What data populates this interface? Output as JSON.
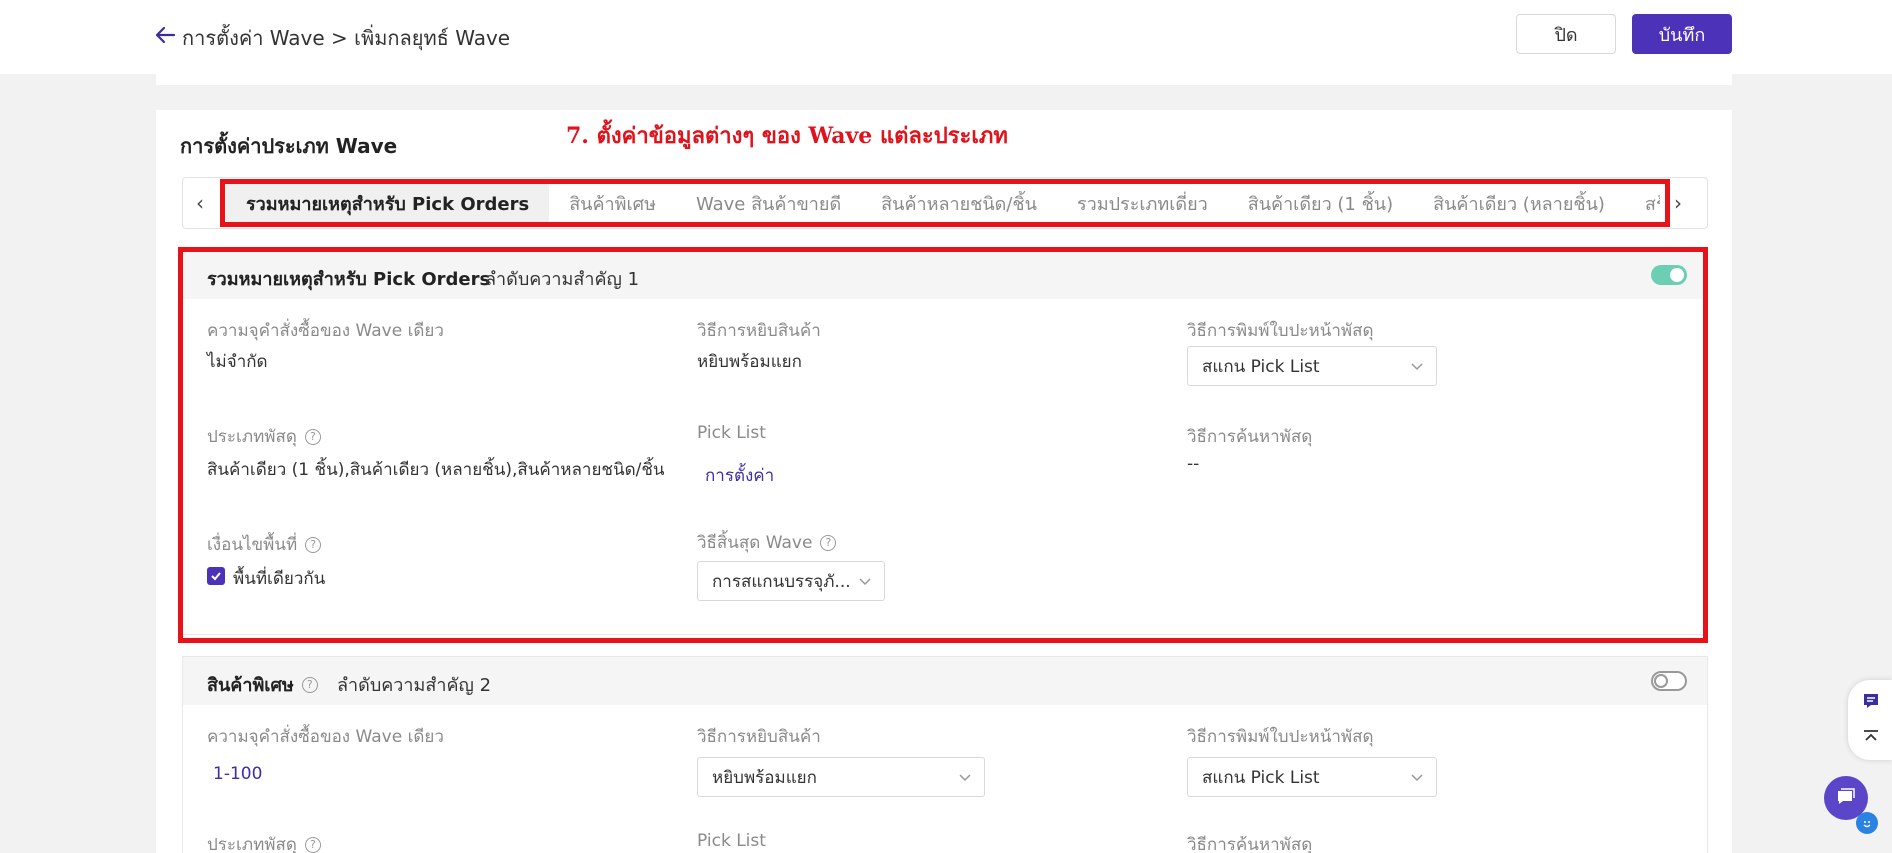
{
  "header": {
    "breadcrumb": "การตั้งค่า Wave > เพิ่มกลยุทธ์ Wave",
    "close_label": "ปิด",
    "save_label": "บันทึก"
  },
  "section": {
    "title": "การตั้งค่าประเภท Wave",
    "annotation": "7. ตั้งค่าข้อมูลต่างๆ ของ Wave แต่ละประเภท"
  },
  "tabs": [
    {
      "label": "รวมหมายเหตุสำหรับ Pick Orders",
      "active": true
    },
    {
      "label": "สินค้าพิเศษ",
      "active": false
    },
    {
      "label": "Wave สินค้าขายดี",
      "active": false
    },
    {
      "label": "สินค้าหลายชนิด/ชิ้น",
      "active": false
    },
    {
      "label": "รวมประเภทเดี่ยว",
      "active": false
    },
    {
      "label": "สินค้าเดียว (1 ชิ้น)",
      "active": false
    },
    {
      "label": "สินค้าเดียว (หลายชิ้น)",
      "active": false
    },
    {
      "label": "สร้างด้วยตนเอง",
      "active": false
    }
  ],
  "panel1": {
    "title": "รวมหมายเหตุสำหรับ Pick Orders",
    "priority": "ลำดับความสำคัญ 1",
    "enabled": true,
    "capacity_label": "ความจุคำสั่งซื้อของ Wave เดียว",
    "capacity_value": "ไม่จำกัด",
    "picking_label": "วิธีการหยิบสินค้า",
    "picking_value": "หยิบพร้อมแยก",
    "print_label": "วิธีการพิมพ์ใบปะหน้าพัสดุ",
    "print_value": "สแกน Pick List",
    "parcel_type_label": "ประเภทพัสดุ",
    "parcel_type_value": "สินค้าเดียว (1 ชิ้น),สินค้าเดียว (หลายชิ้น),สินค้าหลายชนิด/ชิ้น",
    "picklist_label": "Pick List",
    "picklist_link": "การตั้งค่า",
    "search_label": "วิธีการค้นหาพัสดุ",
    "search_value": "--",
    "area_label": "เงื่อนไขพื้นที่",
    "area_checkbox": "พื้นที่เดียวกัน",
    "end_label": "วิธีสิ้นสุด Wave",
    "end_value": "การสแกนบรรจุภั..."
  },
  "panel2": {
    "title": "สินค้าพิเศษ",
    "priority": "ลำดับความสำคัญ 2",
    "enabled": false,
    "capacity_label": "ความจุคำสั่งซื้อของ Wave เดียว",
    "capacity_value": "1-100",
    "picking_label": "วิธีการหยิบสินค้า",
    "picking_value": "หยิบพร้อมแยก",
    "print_label": "วิธีการพิมพ์ใบปะหน้าพัสดุ",
    "print_value": "สแกน Pick List",
    "parcel_type_label": "ประเภทพัสดุ",
    "picklist_label": "Pick List",
    "search_label": "วิธีการค้นหาพัสดุ"
  },
  "colors": {
    "primary": "#4c32b8",
    "annotation_red": "#e8121b",
    "toggle_on": "#6ccfb3"
  }
}
